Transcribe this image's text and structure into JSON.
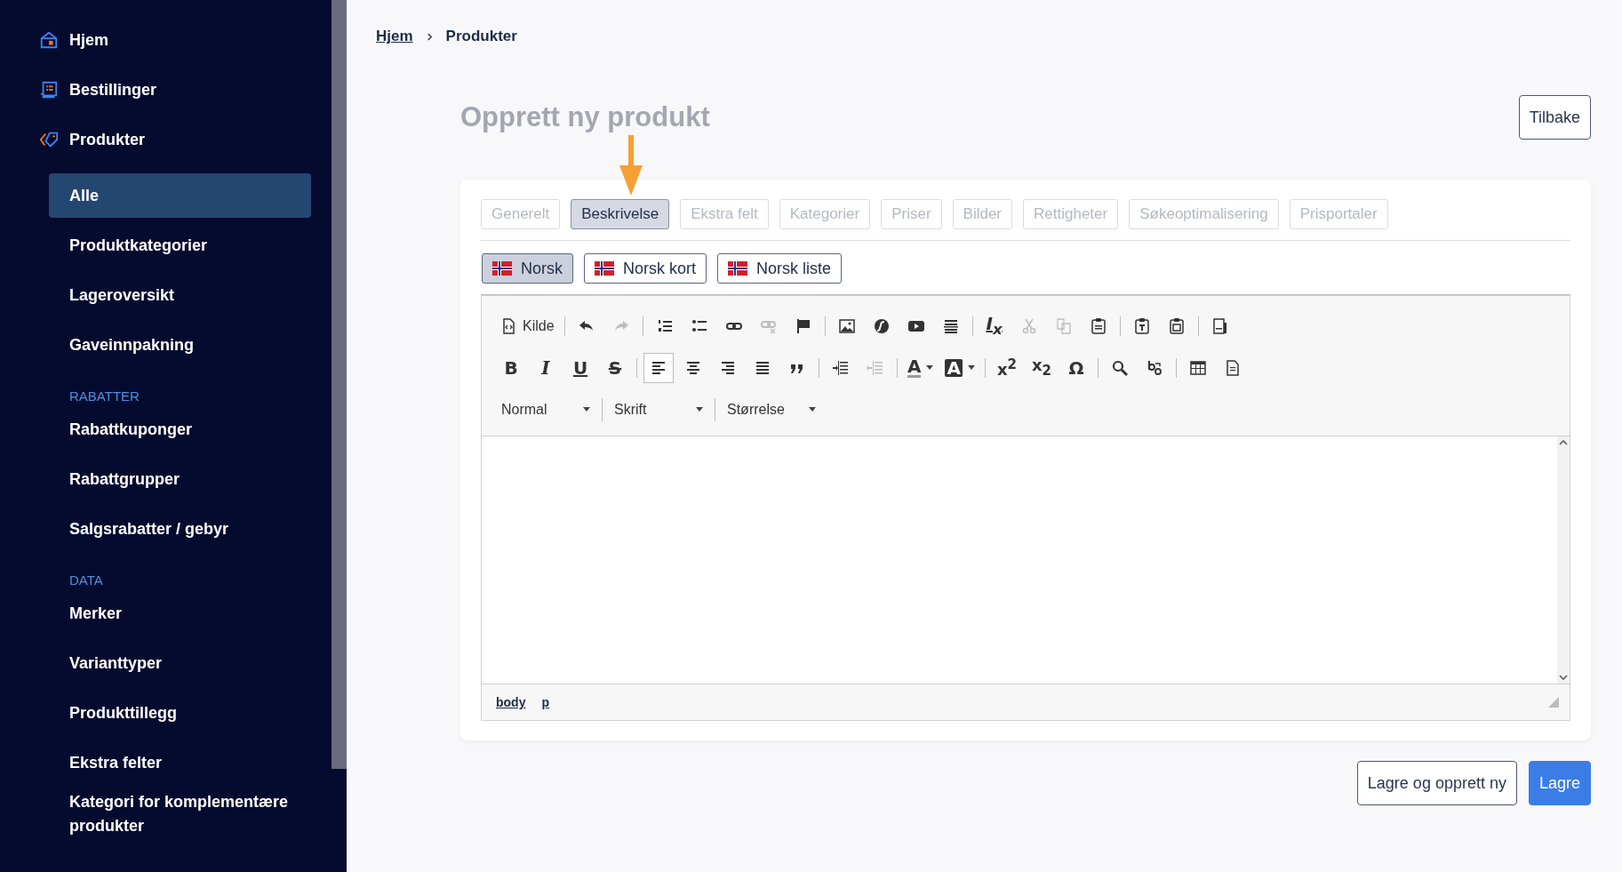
{
  "sidebar": {
    "nav": [
      {
        "label": "Hjem"
      },
      {
        "label": "Bestillinger"
      },
      {
        "label": "Produkter"
      }
    ],
    "sub_items": [
      {
        "label": "Alle",
        "selected": true
      },
      {
        "label": "Produktkategorier",
        "selected": false
      },
      {
        "label": "Lageroversikt",
        "selected": false
      },
      {
        "label": "Gaveinnpakning",
        "selected": false
      }
    ],
    "sections": [
      {
        "heading": "RABATTER",
        "items": [
          "Rabattkuponger",
          "Rabattgrupper",
          "Salgsrabatter / gebyr"
        ]
      },
      {
        "heading": "DATA",
        "items": [
          "Merker",
          "Varianttyper",
          "Produkttillegg",
          "Ekstra felter",
          "Kategori for komplementære produkter"
        ]
      }
    ]
  },
  "breadcrumb": [
    {
      "label": "Hjem",
      "link": true
    },
    {
      "label": "Produkter",
      "link": false
    }
  ],
  "title": "Opprett ny produkt",
  "back_button": "Tilbake",
  "tabs": [
    {
      "label": "Generelt",
      "selected": false
    },
    {
      "label": "Beskrivelse",
      "selected": true
    },
    {
      "label": "Ekstra felt",
      "selected": false
    },
    {
      "label": "Kategorier",
      "selected": false
    },
    {
      "label": "Priser",
      "selected": false
    },
    {
      "label": "Bilder",
      "selected": false
    },
    {
      "label": "Rettigheter",
      "selected": false
    },
    {
      "label": "Søkeoptimalisering",
      "selected": false
    },
    {
      "label": "Prisportaler",
      "selected": false
    }
  ],
  "languages": [
    {
      "label": "Norsk",
      "selected": true
    },
    {
      "label": "Norsk kort",
      "selected": false
    },
    {
      "label": "Norsk liste",
      "selected": false
    }
  ],
  "toolbar_rows": [
    [
      {
        "kind": "source",
        "label": "Kilde",
        "disabled": false,
        "on": false
      },
      {
        "kind": "separator"
      },
      {
        "kind": "undo",
        "disabled": false,
        "on": false
      },
      {
        "kind": "redo",
        "disabled": true,
        "on": false
      },
      {
        "kind": "separator"
      },
      {
        "kind": "numbered-list",
        "disabled": false,
        "on": false
      },
      {
        "kind": "bulleted-list",
        "disabled": false,
        "on": false
      },
      {
        "kind": "link",
        "disabled": false,
        "on": false
      },
      {
        "kind": "unlink",
        "disabled": true,
        "on": false
      },
      {
        "kind": "anchor",
        "disabled": false,
        "on": false
      },
      {
        "kind": "separator"
      },
      {
        "kind": "image",
        "disabled": false,
        "on": false
      },
      {
        "kind": "flash",
        "disabled": false,
        "on": false
      },
      {
        "kind": "youtube",
        "disabled": false,
        "on": false
      },
      {
        "kind": "hr",
        "disabled": false,
        "on": false
      },
      {
        "kind": "separator"
      },
      {
        "kind": "remove-format",
        "glyph": "I$_{x}$",
        "disabled": false,
        "on": false
      },
      {
        "kind": "cut",
        "disabled": true,
        "on": false
      },
      {
        "kind": "copy",
        "disabled": true,
        "on": false
      },
      {
        "kind": "paste",
        "disabled": false,
        "on": false
      },
      {
        "kind": "separator"
      },
      {
        "kind": "paste-text",
        "disabled": false,
        "on": false
      },
      {
        "kind": "paste-word",
        "disabled": false,
        "on": false
      },
      {
        "kind": "separator"
      },
      {
        "kind": "page",
        "disabled": false,
        "on": false
      }
    ],
    [
      {
        "kind": "bold",
        "glyph": "B",
        "disabled": false,
        "on": false
      },
      {
        "kind": "italic",
        "glyph": "I",
        "disabled": false,
        "on": false
      },
      {
        "kind": "underline",
        "glyph": "U",
        "disabled": false,
        "on": false
      },
      {
        "kind": "strike",
        "glyph": "S",
        "disabled": false,
        "on": false
      },
      {
        "kind": "separator"
      },
      {
        "kind": "align-left",
        "disabled": false,
        "on": true
      },
      {
        "kind": "align-center",
        "disabled": false,
        "on": false
      },
      {
        "kind": "align-right",
        "disabled": false,
        "on": false
      },
      {
        "kind": "justify",
        "disabled": false,
        "on": false
      },
      {
        "kind": "blockquote",
        "disabled": false,
        "on": false
      },
      {
        "kind": "separator"
      },
      {
        "kind": "indent",
        "disabled": false,
        "on": false
      },
      {
        "kind": "outdent",
        "disabled": true,
        "on": false
      },
      {
        "kind": "separator"
      },
      {
        "kind": "text-color",
        "glyph": "A",
        "disabled": false,
        "on": false
      },
      {
        "kind": "bg-color",
        "glyph": "A",
        "disabled": false,
        "on": false
      },
      {
        "kind": "separator"
      },
      {
        "kind": "superscript",
        "glyph": "x$^{2}$",
        "disabled": false,
        "on": false
      },
      {
        "kind": "subscript",
        "glyph": "x$_{2}$",
        "disabled": false,
        "on": false
      },
      {
        "kind": "special-char",
        "glyph": "Ω",
        "disabled": false,
        "on": false
      },
      {
        "kind": "separator"
      },
      {
        "kind": "find",
        "disabled": false,
        "on": false
      },
      {
        "kind": "replace",
        "disabled": false,
        "on": false
      },
      {
        "kind": "separator"
      },
      {
        "kind": "table",
        "disabled": false,
        "on": false
      },
      {
        "kind": "preview",
        "disabled": false,
        "on": false
      }
    ]
  ],
  "dropdowns": [
    "Normal",
    "Skrift",
    "Størrelse"
  ],
  "element_path": [
    "body",
    "p"
  ],
  "buttons": [
    {
      "label": "Lagre og opprett ny",
      "kind": "secondary"
    },
    {
      "label": "Lagre",
      "kind": "primary"
    }
  ]
}
